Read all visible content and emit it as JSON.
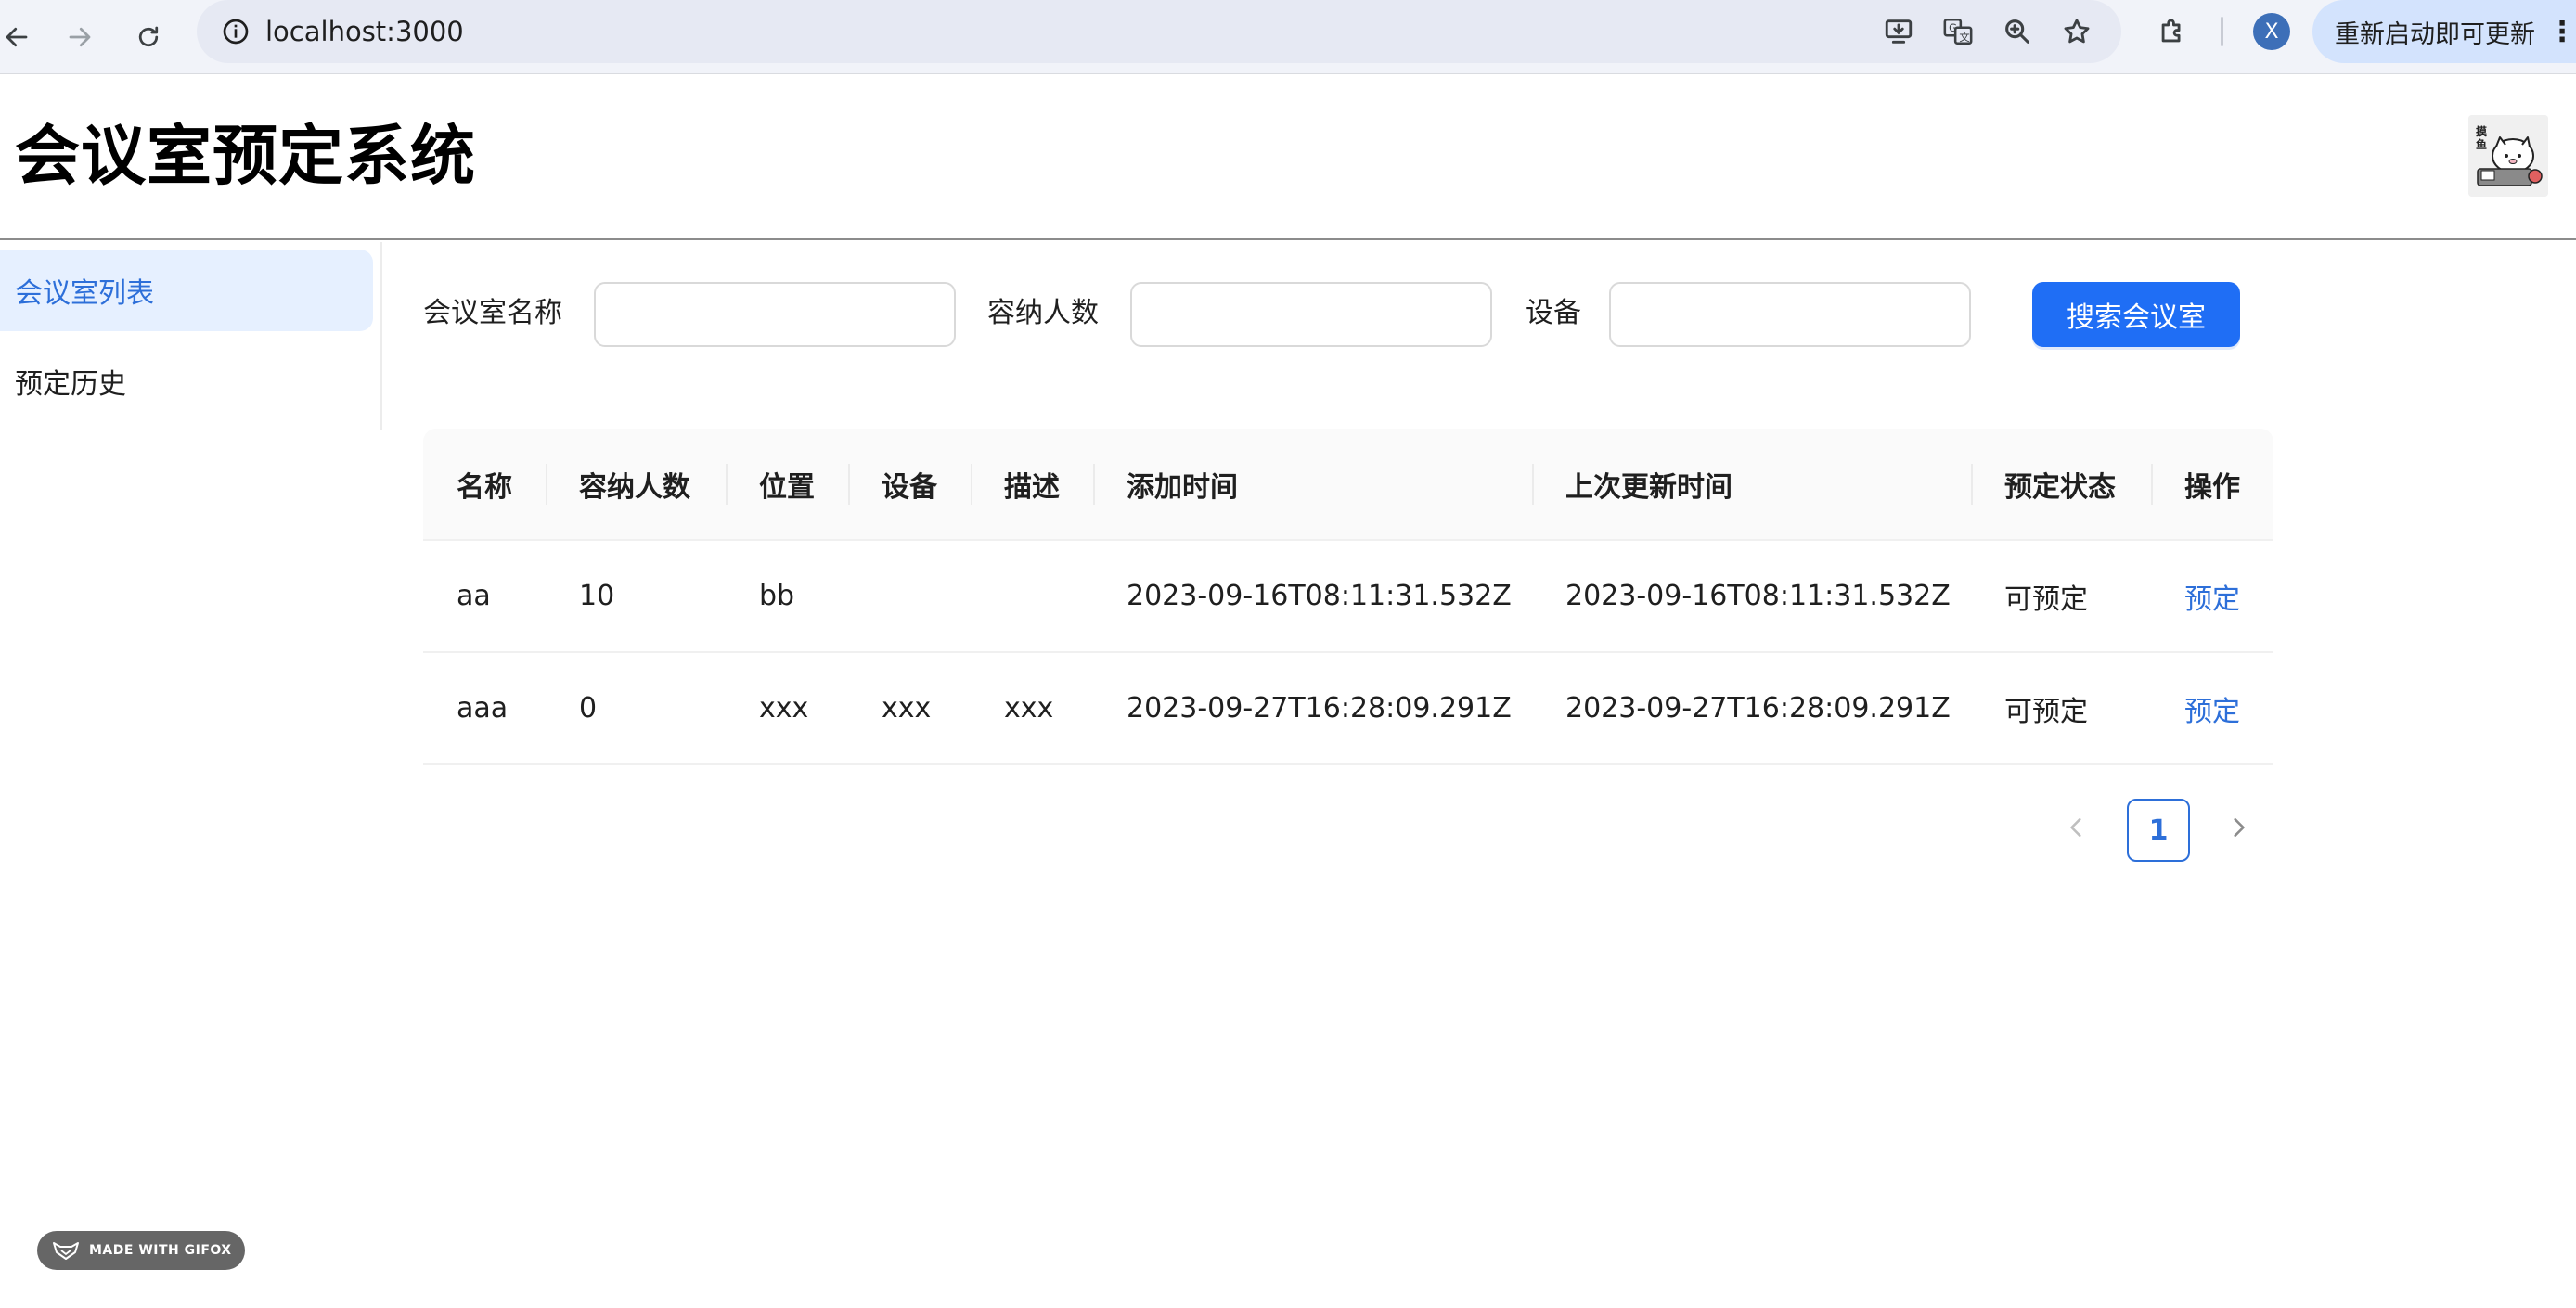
{
  "browser": {
    "url": "localhost:3000",
    "profile_initial": "X",
    "update_label": "重新启动即可更新"
  },
  "header": {
    "title": "会议室预定系统"
  },
  "sidebar": {
    "items": [
      {
        "label": "会议室列表",
        "active": true
      },
      {
        "label": "预定历史",
        "active": false
      }
    ]
  },
  "search": {
    "name_label": "会议室名称",
    "name_value": "",
    "capacity_label": "容纳人数",
    "capacity_value": "",
    "equipment_label": "设备",
    "equipment_value": "",
    "submit_label": "搜索会议室"
  },
  "table": {
    "columns": [
      "名称",
      "容纳人数",
      "位置",
      "设备",
      "描述",
      "添加时间",
      "上次更新时间",
      "预定状态",
      "操作"
    ],
    "rows": [
      [
        "aa",
        "10",
        "bb",
        "",
        "",
        "2023-09-16T08:11:31.532Z",
        "2023-09-16T08:11:31.532Z",
        "可预定",
        "预定"
      ],
      [
        "aaa",
        "0",
        "xxx",
        "xxx",
        "xxx",
        "2023-09-27T16:28:09.291Z",
        "2023-09-27T16:28:09.291Z",
        "可预定",
        "预定"
      ]
    ]
  },
  "pagination": {
    "current_page": "1"
  },
  "watermark": {
    "label": "MADE WITH GIFOX"
  },
  "colors": {
    "primary": "#1f6ef5",
    "link": "#2d6fd9",
    "active_menu_bg": "#e6f0ff"
  }
}
